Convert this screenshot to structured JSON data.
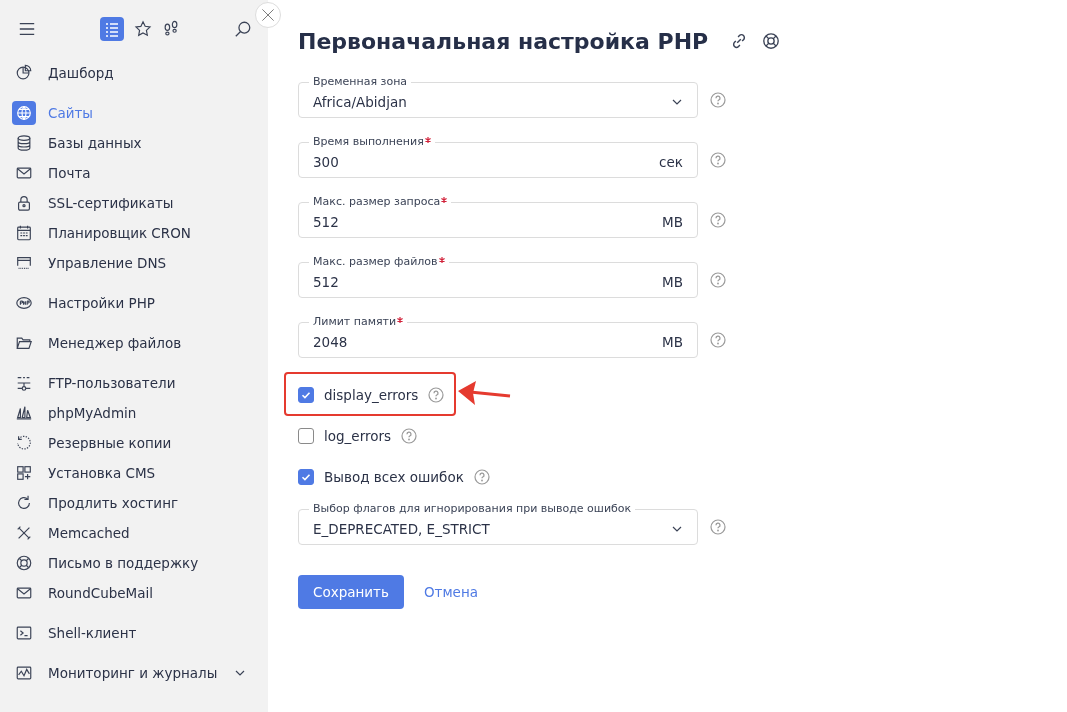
{
  "sidebar": {
    "groups": [
      {
        "items": [
          {
            "label": "Дашборд",
            "selected": false
          }
        ]
      },
      {
        "items": [
          {
            "label": "Сайты",
            "selected": true
          },
          {
            "label": "Базы данных",
            "selected": false
          },
          {
            "label": "Почта",
            "selected": false
          },
          {
            "label": "SSL-сертификаты",
            "selected": false
          },
          {
            "label": "Планировщик CRON",
            "selected": false
          },
          {
            "label": "Управление DNS",
            "selected": false
          }
        ]
      },
      {
        "items": [
          {
            "label": "Настройки PHP",
            "selected": false
          }
        ]
      },
      {
        "items": [
          {
            "label": "Менеджер файлов",
            "selected": false
          }
        ]
      },
      {
        "items": [
          {
            "label": "FTP-пользователи",
            "selected": false
          },
          {
            "label": "phpMyAdmin",
            "selected": false
          },
          {
            "label": "Резервные копии",
            "selected": false
          },
          {
            "label": "Установка CMS",
            "selected": false
          },
          {
            "label": "Продлить хостинг",
            "selected": false
          },
          {
            "label": "Memcached",
            "selected": false
          },
          {
            "label": "Письмо в поддержку",
            "selected": false
          },
          {
            "label": "RoundCubeMail",
            "selected": false
          }
        ]
      },
      {
        "items": [
          {
            "label": "Shell-клиент",
            "selected": false
          }
        ]
      },
      {
        "items": [
          {
            "label": "Мониторинг и журналы",
            "selected": false,
            "expanded": false
          }
        ]
      }
    ]
  },
  "title": "Первоначальная настройка PHP",
  "fields": [
    {
      "kind": "select",
      "label": "Временная зона",
      "required": false,
      "value": "Africa/Abidjan"
    },
    {
      "kind": "input",
      "label": "Время выполнения",
      "required": true,
      "value": "300",
      "unit": "сек"
    },
    {
      "kind": "input",
      "label": "Макс. размер запроса",
      "required": true,
      "value": "512",
      "unit": "MB"
    },
    {
      "kind": "input",
      "label": "Макс. размер файлов",
      "required": true,
      "value": "512",
      "unit": "MB"
    },
    {
      "kind": "input",
      "label": "Лимит памяти",
      "required": true,
      "value": "2048",
      "unit": "MB"
    },
    {
      "kind": "checkbox",
      "label": "display_errors",
      "checked": true,
      "highlighted": true
    },
    {
      "kind": "checkbox",
      "label": "log_errors",
      "checked": false,
      "highlighted": false
    },
    {
      "kind": "checkbox",
      "label": "Вывод всех ошибок",
      "checked": true,
      "highlighted": false
    },
    {
      "kind": "select",
      "label": "Выбор флагов для игнорирования при выводе ошибок",
      "required": false,
      "value": "E_DEPRECATED, E_STRICT"
    }
  ],
  "buttons": {
    "save": "Сохранить",
    "cancel": "Отмена"
  }
}
